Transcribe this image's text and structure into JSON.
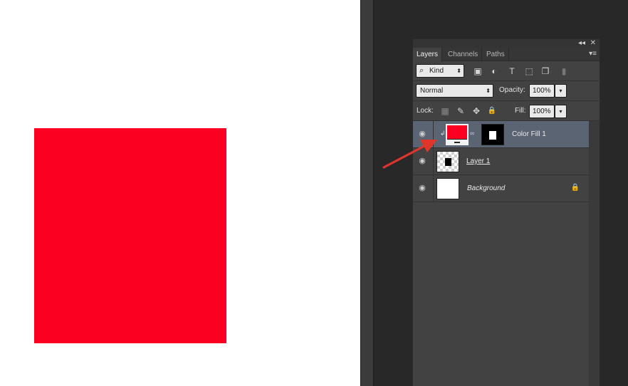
{
  "canvas": {
    "fill_color": "#fb0020"
  },
  "panel": {
    "controls": {
      "collapse_icon": "double-chevron-left-icon",
      "close_icon": "close-icon",
      "collapse_glyph": "◂◂",
      "close_glyph": "✕"
    },
    "tabs": [
      {
        "label": "Layers",
        "active": true
      },
      {
        "label": "Channels",
        "active": false
      },
      {
        "label": "Paths",
        "active": false
      }
    ],
    "menu_glyph": "▾≡",
    "filter": {
      "search_glyph": "⌕",
      "kind_label": "Kind",
      "arrows": "⬍",
      "icons": [
        "image-filter-icon",
        "adjustment-filter-icon",
        "type-filter-icon",
        "shape-filter-icon",
        "smart-object-filter-icon",
        "filter-toggle-icon"
      ],
      "glyphs": [
        "▣",
        "◐",
        "T",
        "⬚",
        "❐",
        "▮"
      ]
    },
    "blend": {
      "mode": "Normal",
      "arrows": "⬍",
      "opacity_label": "Opacity:",
      "opacity_value": "100%",
      "dropdown_glyph": "▾"
    },
    "lock": {
      "label": "Lock:",
      "icons": [
        "lock-transparent-pixels-icon",
        "lock-image-pixels-icon",
        "lock-position-icon",
        "lock-all-icon"
      ],
      "glyphs": [
        "▦",
        "✎",
        "✥",
        "🔒"
      ],
      "fill_label": "Fill:",
      "fill_value": "100%",
      "dropdown_glyph": "▾"
    },
    "layers": [
      {
        "name": "Color Fill 1",
        "selected": true,
        "visible": true,
        "fill_color": "#fb0020",
        "clip_glyph": "↲",
        "link_glyph": "∞"
      },
      {
        "name": "Layer 1",
        "selected": false,
        "visible": true
      },
      {
        "name": "Background",
        "selected": false,
        "visible": true,
        "locked": true,
        "lock_glyph": "🔒"
      }
    ],
    "eye_glyph": "◉"
  },
  "annotation": {
    "arrow_color": "#e0352b"
  }
}
